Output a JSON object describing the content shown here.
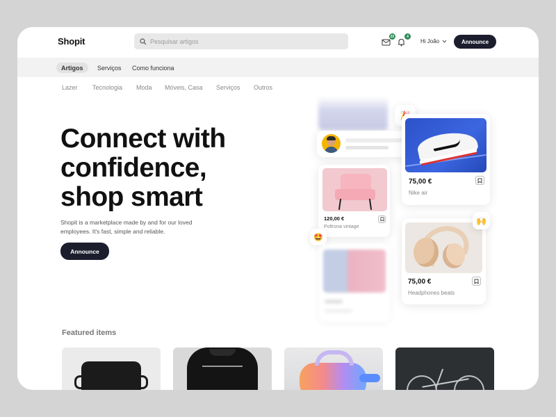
{
  "header": {
    "logo": "Shopit",
    "search_placeholder": "Pesquisar artigos",
    "messages_count": "22",
    "notifications_count": "4",
    "greeting": "Hi João",
    "announce_label": "Announce"
  },
  "tabs": [
    {
      "label": "Artigos",
      "active": true
    },
    {
      "label": "Serviços",
      "active": false
    },
    {
      "label": "Como funciona",
      "active": false
    }
  ],
  "categories": [
    "Lazer",
    "Tecnologia",
    "Moda",
    "Móveis, Casa",
    "Serviços",
    "Outros"
  ],
  "hero": {
    "title": "Connect with confidence, shop smart",
    "subtitle": "Shopit is a marketplace made by and for our loved employees. It's fast, simple and reliable.",
    "cta_label": "Announce"
  },
  "products": [
    {
      "price": "75,00 €",
      "name": "Nike air"
    },
    {
      "price": "120,00 €",
      "name": "Poltrona vintage"
    },
    {
      "price": "75,00 €",
      "name": "Headphones beats"
    }
  ],
  "emojis": {
    "party": "🎉",
    "star_struck": "🤩",
    "raised_hands": "🙌"
  },
  "featured": {
    "title": "Featured items"
  },
  "colors": {
    "primary_dark": "#1c1e2e",
    "badge_green": "#2e8b57",
    "tab_bar": "#f2f2f2"
  }
}
